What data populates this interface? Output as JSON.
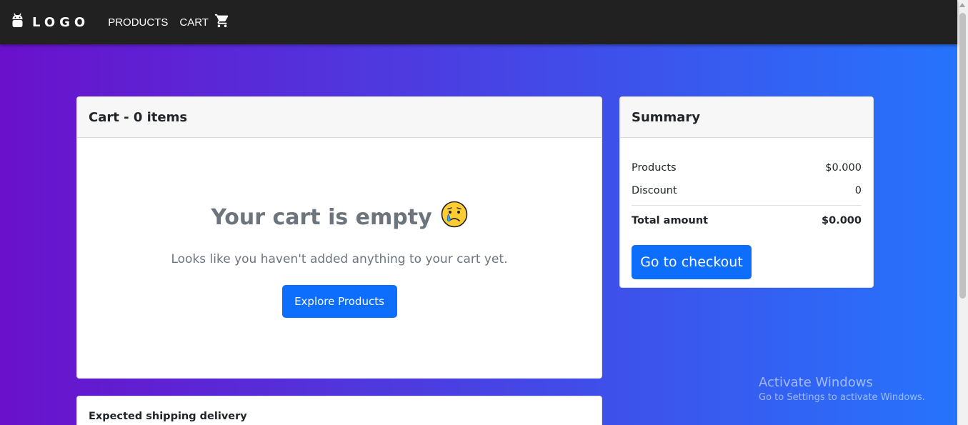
{
  "navbar": {
    "logo_icon": "android-icon",
    "logo_text": "LOGO",
    "products_link": "PRODUCTS",
    "cart_link": "CART",
    "cart_icon": "shopping-cart-icon"
  },
  "cart": {
    "header": "Cart - 0 items",
    "empty_title": "Your cart is empty",
    "empty_emoji": "crying-face-icon",
    "empty_message": "Looks like you haven't added anything to your cart yet.",
    "explore_button": "Explore Products"
  },
  "summary": {
    "header": "Summary",
    "products_label": "Products",
    "products_value": "$0.000",
    "discount_label": "Discount",
    "discount_value": "0",
    "total_label": "Total amount",
    "total_value": "$0.000",
    "checkout_button": "Go to checkout"
  },
  "shipping": {
    "title": "Expected shipping delivery"
  },
  "watermark": {
    "title": "Activate Windows",
    "subtitle": "Go to Settings to activate Windows."
  },
  "colors": {
    "navbar_bg": "#212121",
    "gradient_start": "#6a11cb",
    "gradient_end": "#2575fc",
    "primary": "#0d6efd",
    "muted_text": "#6c757d"
  }
}
